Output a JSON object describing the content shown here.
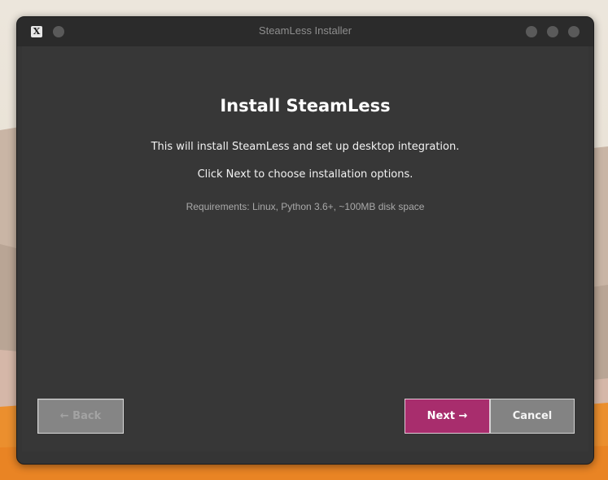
{
  "window": {
    "title": "SteamLess Installer",
    "app_icon_glyph": "X",
    "app_icon_name": "x11-app-icon"
  },
  "installer": {
    "heading": "Install SteamLess",
    "description": "This will install SteamLess and set up desktop integration.",
    "instruction": "Click Next to choose installation options.",
    "requirements": "Requirements: Linux, Python 3.6+, ~100MB disk space"
  },
  "buttons": {
    "back_label": "← Back",
    "next_label": "Next →",
    "cancel_label": "Cancel",
    "back_enabled": false
  },
  "colors": {
    "accent": "#a82d6d",
    "window_bg": "#353535",
    "titlebar_bg": "#2b2b2b"
  }
}
